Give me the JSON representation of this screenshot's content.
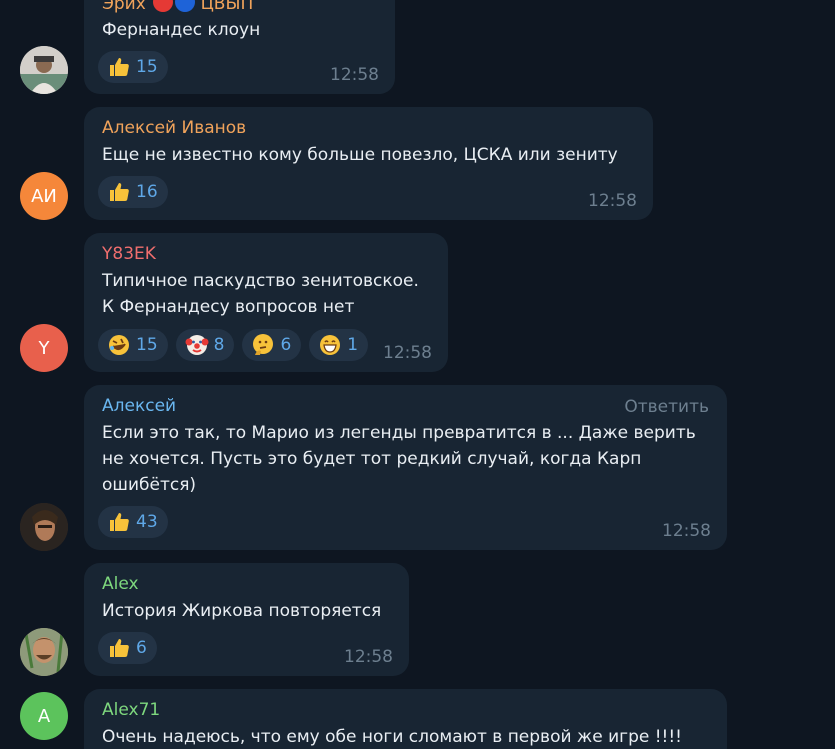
{
  "colors": {
    "background": "#0e1621",
    "bubble": "#182533",
    "reaction_bg": "#233345",
    "reaction_count": "#5fa8e8",
    "time": "#6d7f8f",
    "text": "#e9eef3"
  },
  "messages": [
    {
      "sender": "Эрих",
      "sender_suffix": "ЦВЫП",
      "sender_color": "#f0a35b",
      "avatar": {
        "type": "photo",
        "icon": "user-photo-icon"
      },
      "text": [
        "Фернандес клоун"
      ],
      "reactions": [
        {
          "emoji": "thumbs-up-icon",
          "count": "15"
        }
      ],
      "time": "12:58"
    },
    {
      "sender": "Алексей Иванов",
      "sender_color": "#f0a35b",
      "avatar": {
        "type": "initials",
        "initials": "АИ",
        "color": "#f5873a"
      },
      "text": [
        "Еще не известно кому больше повезло, ЦСКА или зениту"
      ],
      "reactions": [
        {
          "emoji": "thumbs-up-icon",
          "count": "16"
        }
      ],
      "time": "12:58"
    },
    {
      "sender": "Y83EK",
      "sender_color": "#f06e6e",
      "avatar": {
        "type": "initials",
        "initials": "Y",
        "color": "#e8604c"
      },
      "text": [
        "Типичное паскудство зенитовское.",
        "К Фернандесу вопросов нет"
      ],
      "reactions": [
        {
          "emoji": "rofl-icon",
          "count": "15"
        },
        {
          "emoji": "clown-icon",
          "count": "8"
        },
        {
          "emoji": "thinking-icon",
          "count": "6"
        },
        {
          "emoji": "grin-icon",
          "count": "1"
        }
      ],
      "time": "12:58"
    },
    {
      "sender": "Алексей",
      "sender_color": "#6ab7f0",
      "reply_label": "Ответить",
      "avatar": {
        "type": "photo",
        "icon": "user-photo-icon"
      },
      "text": [
        "Если это так, то Марио из легенды превратится в ... Даже верить",
        "не хочется. Пусть это будет тот редкий случай, когда Карп",
        "ошибётся)"
      ],
      "reactions": [
        {
          "emoji": "thumbs-up-icon",
          "count": "43"
        }
      ],
      "time": "12:58"
    },
    {
      "sender": "Alex",
      "sender_color": "#7ed87e",
      "avatar": {
        "type": "photo",
        "icon": "user-photo-icon"
      },
      "text": [
        "История Жиркова повторяется"
      ],
      "reactions": [
        {
          "emoji": "thumbs-up-icon",
          "count": "6"
        }
      ],
      "time": "12:58"
    },
    {
      "sender": "Alex71",
      "sender_color": "#7ed87e",
      "avatar": {
        "type": "initials",
        "initials": "A",
        "color": "#5cc35c"
      },
      "text": [
        "Очень надеюсь, что ему обе ноги сломают в первой же игре !!!!"
      ],
      "reactions": [],
      "time": ""
    }
  ]
}
